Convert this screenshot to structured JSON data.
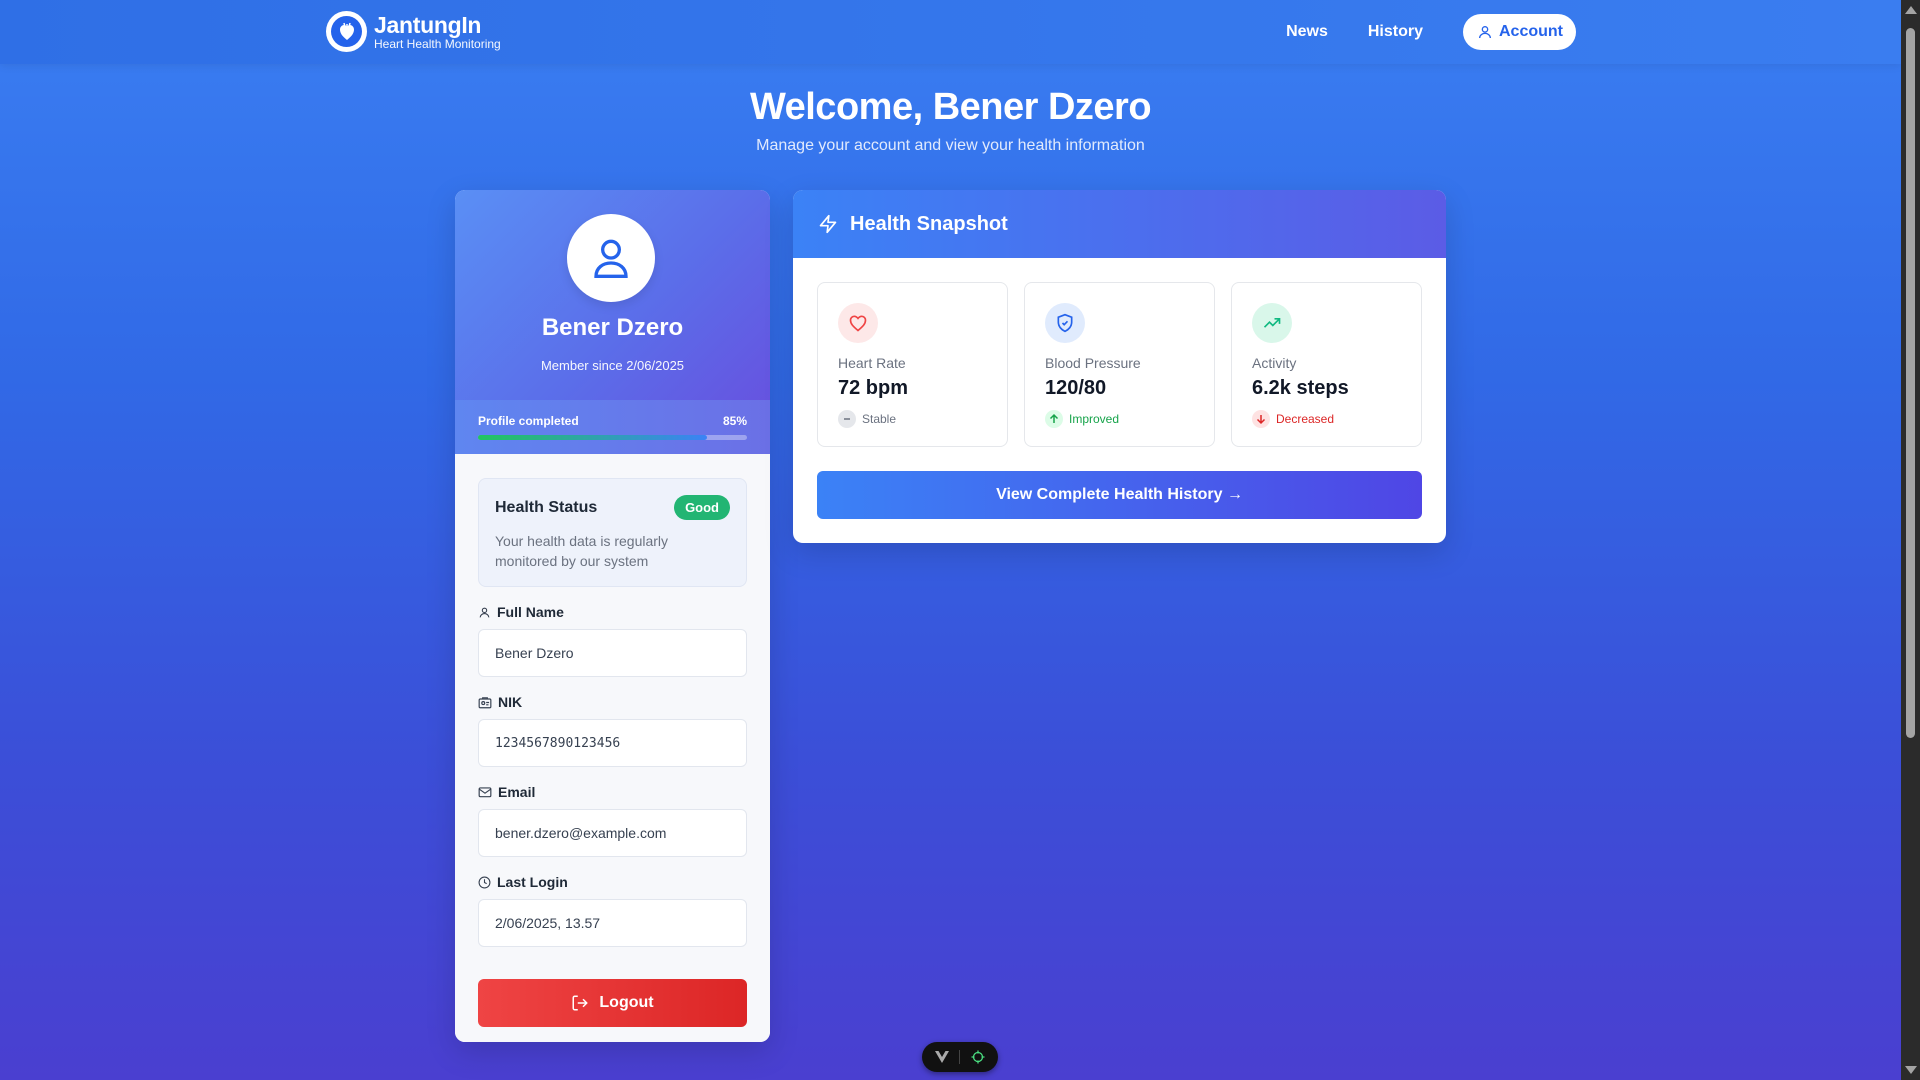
{
  "navbar": {
    "brand_name": "JantungIn",
    "brand_sub": "Heart Health Monitoring",
    "links": {
      "news": "News",
      "history": "History"
    },
    "account_label": "Account"
  },
  "header": {
    "title": "Welcome, Bener Dzero",
    "subtitle": "Manage your account and view your health information"
  },
  "profile": {
    "name": "Bener Dzero",
    "member_since": "Member since 2/06/2025",
    "progress_label": "Profile completed",
    "progress_text": "85%",
    "progress_value": 0.85,
    "health_status": {
      "title": "Health Status",
      "badge": "Good",
      "description": "Your health data is regularly monitored by our system"
    },
    "fields": {
      "full_name": {
        "label": "Full Name",
        "value": "Bener Dzero"
      },
      "nik": {
        "label": "NIK",
        "value": "1234567890123456"
      },
      "email": {
        "label": "Email",
        "value": "bener.dzero@example.com"
      },
      "last_login": {
        "label": "Last Login",
        "value": "2/06/2025, 13.57"
      }
    },
    "logout_label": "Logout"
  },
  "snapshot": {
    "title": "Health Snapshot",
    "metrics": [
      {
        "label": "Heart Rate",
        "value": "72 bpm",
        "trend": "Stable",
        "icon": "heart-icon",
        "trend_icon": "minus-icon",
        "color": "#ef4444"
      },
      {
        "label": "Blood Pressure",
        "value": "120/80",
        "trend": "Improved",
        "icon": "shield-icon",
        "trend_icon": "arrow-up-icon",
        "color": "#2563eb"
      },
      {
        "label": "Activity",
        "value": "6.2k steps",
        "trend": "Decreased",
        "icon": "trending-up-icon",
        "trend_icon": "arrow-down-icon",
        "color": "#10b981"
      }
    ],
    "history_button": "View Complete Health History →"
  },
  "colors": {
    "primary": "#3b82f6",
    "good": "#22b573",
    "danger": "#ef4444",
    "improved": "#16a34a",
    "decreased": "#dc2626"
  }
}
